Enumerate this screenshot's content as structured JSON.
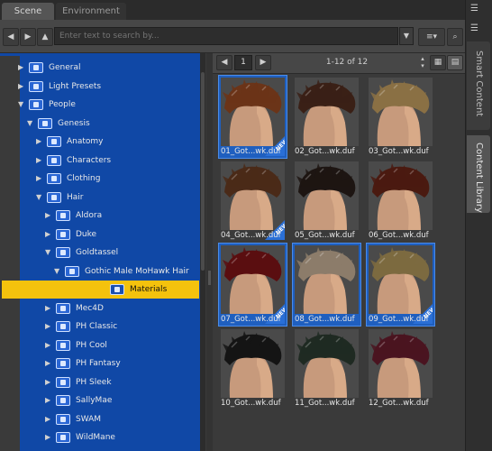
{
  "tabs": {
    "scene": "Scene",
    "environment": "Environment"
  },
  "search": {
    "placeholder": "Enter text to search by..."
  },
  "right_tabs": {
    "smart": "Smart Content",
    "library": "Content Library"
  },
  "tree": {
    "items": [
      {
        "label": "General",
        "expanded": false
      },
      {
        "label": "Light Presets",
        "expanded": false
      },
      {
        "label": "People",
        "expanded": true
      },
      {
        "label": "Genesis",
        "expanded": true
      },
      {
        "label": "Anatomy",
        "expanded": false
      },
      {
        "label": "Characters",
        "expanded": false
      },
      {
        "label": "Clothing",
        "expanded": false
      },
      {
        "label": "Hair",
        "expanded": true
      },
      {
        "label": "Aldora",
        "expanded": false
      },
      {
        "label": "Duke",
        "expanded": false
      },
      {
        "label": "Goldtassel",
        "expanded": true
      },
      {
        "label": "Gothic Male MoHawk Hair",
        "expanded": true
      },
      {
        "label": "Materials",
        "selected": true
      },
      {
        "label": "Mec4D",
        "expanded": false
      },
      {
        "label": "PH Classic",
        "expanded": false
      },
      {
        "label": "PH Cool",
        "expanded": false
      },
      {
        "label": "PH Fantasy",
        "expanded": false
      },
      {
        "label": "PH Sleek",
        "expanded": false
      },
      {
        "label": "SallyMae",
        "expanded": false
      },
      {
        "label": "SWAM",
        "expanded": false
      },
      {
        "label": "WildMane",
        "expanded": false
      }
    ]
  },
  "content": {
    "page": "1",
    "count": "1-12 of 12",
    "new_badge": "NEW",
    "items": [
      {
        "caption": "01_Got...wk.duf",
        "color": "#6b3418",
        "new": true,
        "selected": true
      },
      {
        "caption": "02_Got...wk.duf",
        "color": "#3a2016",
        "new": false,
        "selected": false
      },
      {
        "caption": "03_Got...wk.duf",
        "color": "#8a7044",
        "new": false,
        "selected": false
      },
      {
        "caption": "04_Got...wk.duf",
        "color": "#4a2a18",
        "new": true,
        "selected": false
      },
      {
        "caption": "05_Got...wk.duf",
        "color": "#1d1512",
        "new": false,
        "selected": false
      },
      {
        "caption": "06_Got...wk.duf",
        "color": "#4a1a10",
        "new": false,
        "selected": false
      },
      {
        "caption": "07_Got...wk.duf",
        "color": "#5a0e10",
        "new": true,
        "selected": true
      },
      {
        "caption": "08_Got...wk.duf",
        "color": "#8c7c6a",
        "new": false,
        "selected": true
      },
      {
        "caption": "09_Got...wk.duf",
        "color": "#7c6a40",
        "new": true,
        "selected": true
      },
      {
        "caption": "10_Got...wk.duf",
        "color": "#141414",
        "new": false,
        "selected": false
      },
      {
        "caption": "11_Got...wk.duf",
        "color": "#1f2a22",
        "new": false,
        "selected": false
      },
      {
        "caption": "12_Got...wk.duf",
        "color": "#4a1420",
        "new": false,
        "selected": false
      }
    ]
  }
}
